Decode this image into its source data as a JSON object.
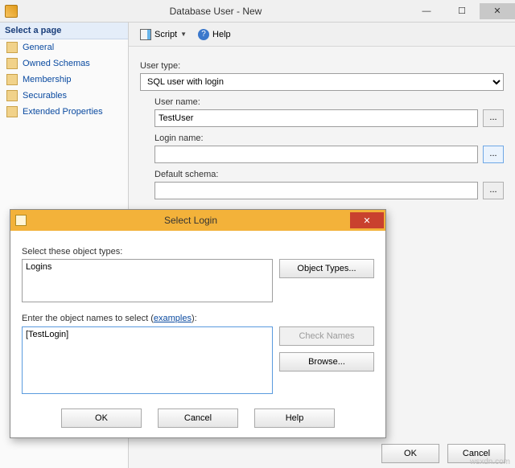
{
  "window": {
    "title": "Database User - New",
    "min": "—",
    "max": "☐",
    "close": "✕"
  },
  "leftnav": {
    "header": "Select a page",
    "items": [
      {
        "label": "General"
      },
      {
        "label": "Owned Schemas"
      },
      {
        "label": "Membership"
      },
      {
        "label": "Securables"
      },
      {
        "label": "Extended Properties"
      }
    ]
  },
  "toolbar": {
    "script": "Script",
    "help": "Help"
  },
  "form": {
    "usertype_label": "User type:",
    "usertype_value": "SQL user with login",
    "username_label": "User name:",
    "username_value": "TestUser",
    "loginname_label": "Login name:",
    "loginname_value": "",
    "defaultschema_label": "Default schema:",
    "defaultschema_value": "",
    "ellipsis": "..."
  },
  "mainfooter": {
    "ok": "OK",
    "cancel": "Cancel"
  },
  "modal": {
    "title": "Select Login",
    "close": "✕",
    "types_label": "Select these object types:",
    "types_value": "Logins",
    "object_types_btn": "Object Types...",
    "names_label_pre": "Enter the object names to select (",
    "names_label_link": "examples",
    "names_label_post": "):",
    "names_value": "[TestLogin]",
    "check_names_btn": "Check Names",
    "browse_btn": "Browse...",
    "ok": "OK",
    "cancel": "Cancel",
    "help": "Help"
  },
  "watermark": "wsxdn.com"
}
